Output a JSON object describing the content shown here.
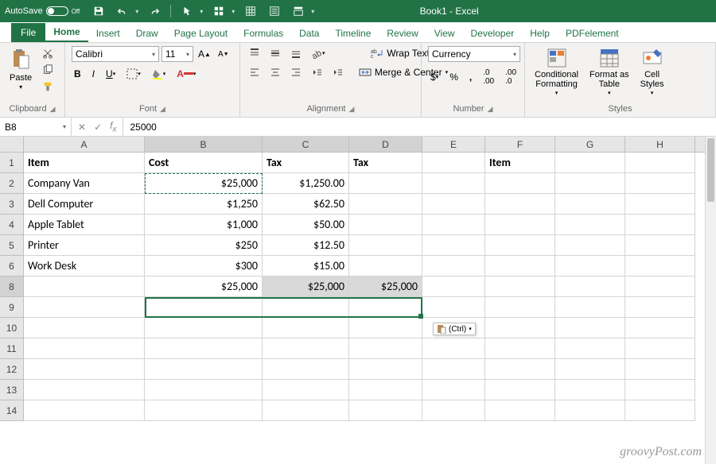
{
  "titlebar": {
    "autosave_label": "AutoSave",
    "autosave_state": "Off",
    "title": "Book1 - Excel"
  },
  "tabs": {
    "file": "File",
    "home": "Home",
    "insert": "Insert",
    "draw": "Draw",
    "pagelayout": "Page Layout",
    "formulas": "Formulas",
    "data": "Data",
    "timeline": "Timeline",
    "review": "Review",
    "view": "View",
    "developer": "Developer",
    "help": "Help",
    "pdfelement": "PDFelement"
  },
  "ribbon": {
    "clipboard": {
      "paste": "Paste",
      "label": "Clipboard"
    },
    "font": {
      "name": "Calibri",
      "size": "11",
      "label": "Font"
    },
    "alignment": {
      "wrap": "Wrap Text",
      "merge": "Merge & Center",
      "label": "Alignment"
    },
    "number": {
      "format": "Currency",
      "label": "Number"
    },
    "styles": {
      "cond": "Conditional\nFormatting",
      "fmt": "Format as\nTable",
      "cell": "Cell\nStyles",
      "label": "Styles"
    }
  },
  "formulabar": {
    "namebox": "B8",
    "value": "25000"
  },
  "columns": [
    "A",
    "B",
    "C",
    "D",
    "E",
    "F",
    "G",
    "H"
  ],
  "grid": {
    "r1": {
      "A": "Item",
      "B": "Cost",
      "C": "Tax",
      "D": "Tax",
      "F": "Item"
    },
    "r2": {
      "A": "Company Van",
      "B": "$25,000",
      "C": "$1,250.00"
    },
    "r3": {
      "A": "Dell Computer",
      "B": "$1,250",
      "C": "$62.50"
    },
    "r4": {
      "A": "Apple Tablet",
      "B": "$1,000",
      "C": "$50.00"
    },
    "r5": {
      "A": "Printer",
      "B": "$250",
      "C": "$12.50"
    },
    "r6": {
      "A": "Work Desk",
      "B": "$300",
      "C": "$15.00"
    },
    "r8": {
      "B": "$25,000",
      "C": "$25,000",
      "D": "$25,000"
    }
  },
  "pasteopts": {
    "label": "(Ctrl)"
  },
  "watermark": "groovyPost.com"
}
